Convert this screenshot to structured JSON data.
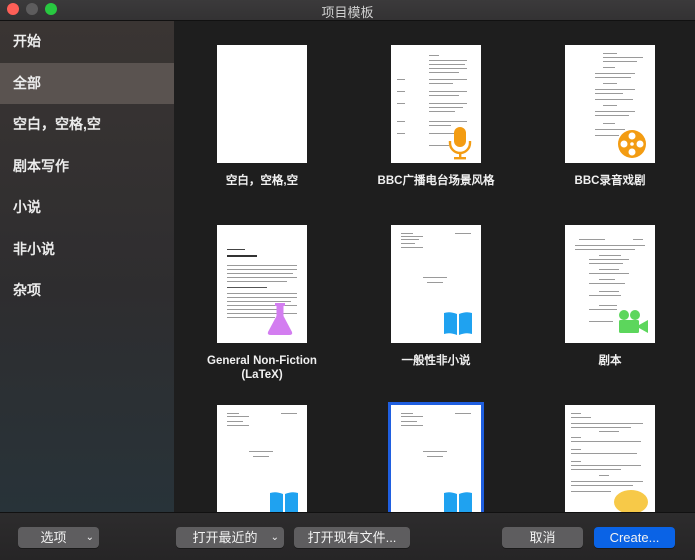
{
  "window": {
    "title": "项目模板"
  },
  "sidebar": {
    "items": [
      {
        "label": "开始",
        "selected": false
      },
      {
        "label": "全部",
        "selected": true
      },
      {
        "label": "空白，空格,空",
        "selected": false
      },
      {
        "label": "剧本写作",
        "selected": false
      },
      {
        "label": "小说",
        "selected": false
      },
      {
        "label": "非小说",
        "selected": false
      },
      {
        "label": "杂项",
        "selected": false
      }
    ]
  },
  "templates": [
    {
      "label": "空白，空格,空",
      "icon": "none"
    },
    {
      "label": "BBC广播电台场景风格",
      "icon": "microphone-icon"
    },
    {
      "label": "BBC录音戏剧",
      "icon": "film-reel-icon"
    },
    {
      "label": "General Non-Fiction\n(LaTeX)",
      "icon": "flask-icon"
    },
    {
      "label": "一般性非小说",
      "icon": "book-icon"
    },
    {
      "label": "剧本",
      "icon": "video-camera-icon"
    },
    {
      "label": "",
      "icon": "book-icon"
    },
    {
      "label": "",
      "icon": "book-icon",
      "selected": true
    },
    {
      "label": "",
      "icon": "speech-bubble-icon"
    }
  ],
  "bottombar": {
    "options_label": "选项",
    "recent_label": "打开最近的",
    "open_existing_label": "打开现有文件...",
    "cancel_label": "取消",
    "create_label": "Create..."
  },
  "colors": {
    "accent": "#0a63e6",
    "selection": "#5a5350",
    "orange": "#f39c12",
    "purple": "#d37df0",
    "green": "#5cd65c",
    "blue": "#1fa2f0",
    "yellow": "#f7c948"
  }
}
